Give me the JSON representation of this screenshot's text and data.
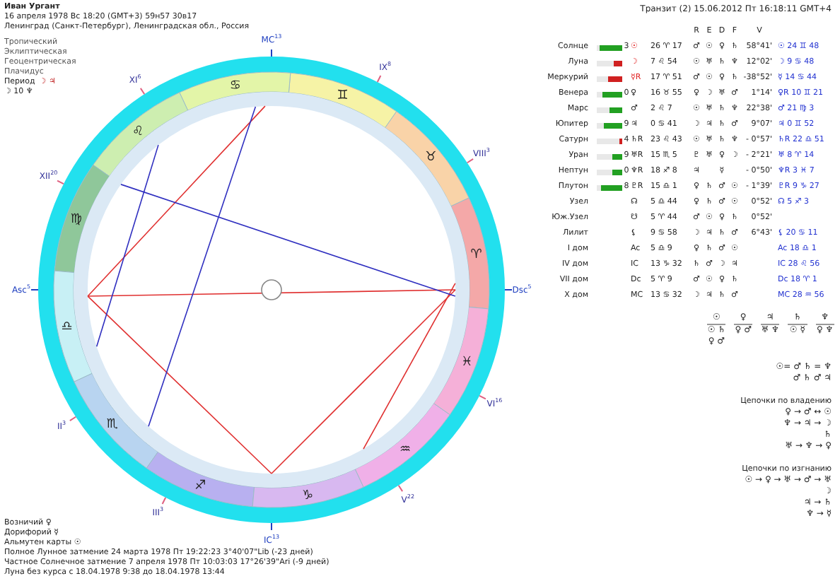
{
  "header": {
    "name": "Иван Ургант",
    "date_line": "16 апреля 1978  Вс  18:20 (GMT+3) 59н57  30в17",
    "place": "Ленинград (Санкт-Петербург), Ленинградская обл., Россия",
    "settings": [
      "Тропический",
      "Эклиптическая",
      "Геоцентрическая",
      "Плачидус"
    ],
    "period_label": "Период",
    "period_glyphs": "☽ ♃",
    "period_sub": "☽ 10 ♆"
  },
  "wheel": {
    "signs": [
      {
        "glyph": "♈",
        "color": "#f4a8a8"
      },
      {
        "glyph": "♉",
        "color": "#f9d3a8"
      },
      {
        "glyph": "♊",
        "color": "#f6f3a6"
      },
      {
        "glyph": "♋",
        "color": "#e3f5a8"
      },
      {
        "glyph": "♌",
        "color": "#cdeeb0"
      },
      {
        "glyph": "♍",
        "color": "#8fc79a"
      },
      {
        "glyph": "♎",
        "color": "#c8f0f5"
      },
      {
        "glyph": "♏",
        "color": "#b8d4f0"
      },
      {
        "glyph": "♐",
        "color": "#b8b0f0"
      },
      {
        "glyph": "♑",
        "color": "#d8b8f0"
      },
      {
        "glyph": "♒",
        "color": "#f0b0e8"
      },
      {
        "glyph": "♓",
        "color": "#f5b0d8"
      }
    ],
    "houses": [
      {
        "label": "Asc",
        "degree": "5"
      },
      {
        "label": "II",
        "degree": "3"
      },
      {
        "label": "III",
        "degree": "3"
      },
      {
        "label": "IC",
        "degree": "13"
      },
      {
        "label": "V",
        "degree": "22"
      },
      {
        "label": "VI",
        "degree": "16"
      },
      {
        "label": "Dsc",
        "degree": "5"
      },
      {
        "label": "VIII",
        "degree": "3"
      },
      {
        "label": "IX",
        "degree": "8"
      },
      {
        "label": "MC",
        "degree": "13"
      },
      {
        "label": "XI",
        "degree": "6"
      },
      {
        "label": "XII",
        "degree": "20"
      }
    ]
  },
  "notes": [
    "Возничий ♀",
    "Дорифорий ☿",
    "Альмутен карты ☉",
    "Полное Лунное затмение 24 марта 1978 Пт 19:22:23  3°40'07\"Lib (-23 дней)",
    "Частное Солнечное затмение 7 апреля 1978 Пт 10:03:03 17°26'39\"Ari (-9 дней)",
    "Луна без курса с 18.04.1978  9:38 до 18.04.1978 13:44"
  ],
  "transit_title": "Транзит (2) 15.06.2012  Пт 16:18:11 GMT+4",
  "table": {
    "columns": [
      "R",
      "E",
      "D",
      "F",
      "V"
    ],
    "rows": [
      {
        "name": "Солнце",
        "bar": {
          "level": 0.9,
          "color": "#22a022"
        },
        "score": "3",
        "glyph": "☉",
        "highlighted": true,
        "position": "26 ♈ 17",
        "r": "♂",
        "e": "☉",
        "d": "♀",
        "f": "♄",
        "v": "58°41'",
        "transit": "☉ 24 ♊ 48"
      },
      {
        "name": "Луна",
        "bar": {
          "level": 0.35,
          "color": "#d02020"
        },
        "glyph": "☽",
        "highlighted": true,
        "position": "7 ♌ 54",
        "r": "☉",
        "e": "♅",
        "d": "♄",
        "f": "♆",
        "v": "12°02'",
        "transit": "☽ 9 ♋ 48"
      },
      {
        "name": "Меркурий",
        "bar": {
          "level": 0.55,
          "color": "#d02020"
        },
        "glyph": "☿R",
        "highlighted": true,
        "position": "17 ♈ 51",
        "r": "♂",
        "e": "☉",
        "d": "♀",
        "f": "♄",
        "v": "-38°52'",
        "transit": "☿ 14 ♋ 44"
      },
      {
        "name": "Венера",
        "bar": {
          "level": 0.8,
          "color": "#22a022"
        },
        "score": "0",
        "glyph": "♀",
        "highlighted": false,
        "position": "16 ♉ 55",
        "r": "♀",
        "e": "☽",
        "d": "♅",
        "f": "♂",
        "v": "1°14'",
        "transit": "♀R 10 ♊ 21"
      },
      {
        "name": "Марс",
        "bar": {
          "level": 0.5,
          "color": "#22a022"
        },
        "glyph": "♂",
        "highlighted": false,
        "position": "2 ♌ 7",
        "r": "☉",
        "e": "♅",
        "d": "♄",
        "f": "♆",
        "v": "22°38'",
        "transit": "♂ 21 ♍ 3"
      },
      {
        "name": "Юпитер",
        "bar": {
          "level": 0.75,
          "color": "#22a022"
        },
        "score": "9",
        "glyph": "♃",
        "highlighted": false,
        "position": "0 ♋ 41",
        "r": "☽",
        "e": "♃",
        "d": "♄",
        "f": "♂",
        "v": "9°07'",
        "transit": "♃ 0 ♊ 52"
      },
      {
        "name": "Сатурн",
        "bar": {
          "level": 0.1,
          "color": "#d02020"
        },
        "score": "4",
        "glyph": "♄R",
        "highlighted": false,
        "position": "23 ♌ 43",
        "r": "☉",
        "e": "♅",
        "d": "♄",
        "f": "♆",
        "v": "- 0°57'",
        "transit": "♄R 22 ♎ 51"
      },
      {
        "name": "Уран",
        "bar": {
          "level": 0.4,
          "color": "#22a022"
        },
        "score": "9",
        "glyph": "♅R",
        "highlighted": false,
        "position": "15 ♏ 5",
        "r": "♇",
        "e": "♅",
        "d": "♀",
        "f": "☽",
        "v": "- 2°21'",
        "transit": "♅ 8 ♈ 14"
      },
      {
        "name": "Нептун",
        "bar": {
          "level": 0.4,
          "color": "#22a022"
        },
        "score": "0",
        "glyph": "♆R",
        "highlighted": false,
        "position": "18 ♐ 8",
        "r": "♃",
        "d": "☿",
        "v": "- 0°50'",
        "transit": "♆R 3 ♓ 7"
      },
      {
        "name": "Плутон",
        "bar": {
          "level": 0.85,
          "color": "#22a022"
        },
        "score": "8",
        "glyph": "♇R",
        "highlighted": false,
        "position": "15 ♎ 1",
        "r": "♀",
        "e": "♄",
        "d": "♂",
        "f": "☉",
        "v": "- 1°39'",
        "transit": "♇R 9 ♑ 27"
      },
      {
        "name": "Узел",
        "glyph": "☊",
        "highlighted": false,
        "position": "5 ♎ 44",
        "r": "♀",
        "e": "♄",
        "d": "♂",
        "f": "☉",
        "v": "0°52'",
        "transit": "☊ 5 ♐ 3"
      },
      {
        "name": "Юж.Узел",
        "glyph": "☋",
        "highlighted": false,
        "position": "5 ♈ 44",
        "r": "♂",
        "e": "☉",
        "d": "♀",
        "f": "♄",
        "v": "0°52'"
      },
      {
        "name": "Лилит",
        "glyph": "⚸",
        "highlighted": false,
        "position": "9 ♋ 58",
        "r": "☽",
        "e": "♃",
        "d": "♄",
        "f": "♂",
        "v": "6°43'",
        "transit": "⚸ 20 ♋ 11"
      },
      {
        "name": "I дом",
        "glyph": "Ac",
        "highlighted": false,
        "position": "5 ♎ 9",
        "r": "♀",
        "e": "♄",
        "d": "♂",
        "f": "☉",
        "transit": "Ac 18 ♎ 1"
      },
      {
        "name": "IV дом",
        "glyph": "IC",
        "highlighted": false,
        "position": "13 ♑ 32",
        "r": "♄",
        "e": "♂",
        "d": "☽",
        "f": "♃",
        "transit": "IC 28 ♌ 56"
      },
      {
        "name": "VII дом",
        "glyph": "Dc",
        "highlighted": false,
        "position": "5 ♈ 9",
        "r": "♂",
        "e": "☉",
        "d": "♀",
        "f": "♄",
        "transit": "Dc 18 ♈ 1"
      },
      {
        "name": "X дом",
        "glyph": "MC",
        "highlighted": false,
        "position": "13 ♋ 32",
        "r": "☽",
        "e": "♃",
        "d": "♄",
        "f": "♂",
        "transit": "MC 28 ♒ 56"
      }
    ]
  },
  "dispositors": [
    {
      "root": "☉",
      "children": [
        "☉ ♄",
        "♀ ♂"
      ]
    },
    {
      "root": "♀",
      "children": [
        "♀ ♂"
      ]
    },
    {
      "root": "♃",
      "children": [
        "♅ ♆"
      ]
    },
    {
      "root": "♄",
      "children": [
        "☉ ☿"
      ]
    },
    {
      "root": "♆",
      "children": [
        "♀ ♆"
      ]
    }
  ],
  "receptions": [
    "☉= ♂ ♄ = ♆",
    "♂ ♄ ♂ ♃"
  ],
  "chain_groups": [
    {
      "title": "Цепочки по владению",
      "lines": [
        "♀ → ♂ ↔ ☉",
        "♆ → ♃ → ☽",
        "♄",
        "♅ → ♆ → ♀"
      ]
    },
    {
      "title": "Цепочки по изгнанию",
      "lines": [
        "☉ → ♀ → ♅ → ♂ → ♅",
        "☽",
        "♃ → ♄",
        "♆ → ☿"
      ]
    }
  ]
}
